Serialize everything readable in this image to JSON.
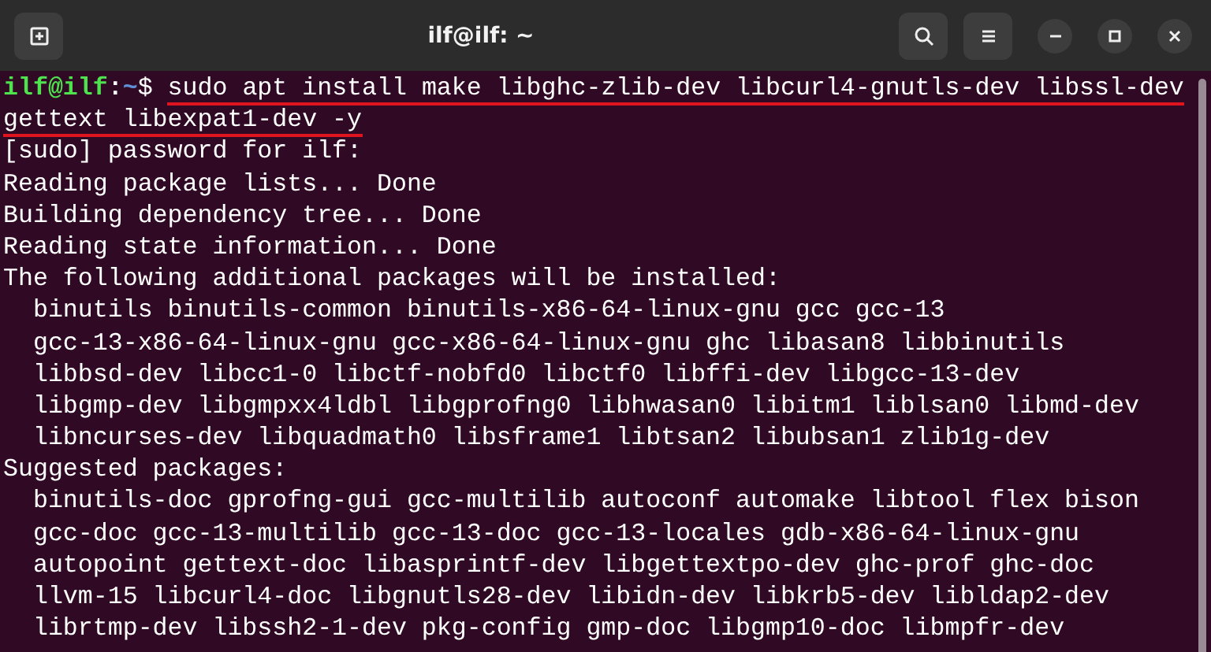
{
  "window": {
    "title": "ilf@ilf: ~"
  },
  "terminal": {
    "lines": [
      {
        "kind": "prompt",
        "user": "ilf@ilf",
        "separator": ":",
        "path": "~",
        "symbol": "$",
        "text": "sudo apt install make libghc-zlib-dev libcurl4-gnutls-dev libssl-dev",
        "underlined": true
      },
      {
        "kind": "output",
        "text": "gettext libexpat1-dev -y",
        "underlined": true
      },
      {
        "kind": "output",
        "text": "[sudo] password for ilf:",
        "underlined": false
      },
      {
        "kind": "output",
        "text": "Reading package lists... Done",
        "underlined": false
      },
      {
        "kind": "output",
        "text": "Building dependency tree... Done",
        "underlined": false
      },
      {
        "kind": "output",
        "text": "Reading state information... Done",
        "underlined": false
      },
      {
        "kind": "output",
        "text": "The following additional packages will be installed:",
        "underlined": false
      },
      {
        "kind": "output",
        "text": "  binutils binutils-common binutils-x86-64-linux-gnu gcc gcc-13",
        "underlined": false
      },
      {
        "kind": "output",
        "text": "  gcc-13-x86-64-linux-gnu gcc-x86-64-linux-gnu ghc libasan8 libbinutils",
        "underlined": false
      },
      {
        "kind": "output",
        "text": "  libbsd-dev libcc1-0 libctf-nobfd0 libctf0 libffi-dev libgcc-13-dev",
        "underlined": false
      },
      {
        "kind": "output",
        "text": "  libgmp-dev libgmpxx4ldbl libgprofng0 libhwasan0 libitm1 liblsan0 libmd-dev",
        "underlined": false
      },
      {
        "kind": "output",
        "text": "  libncurses-dev libquadmath0 libsframe1 libtsan2 libubsan1 zlib1g-dev",
        "underlined": false
      },
      {
        "kind": "output",
        "text": "Suggested packages:",
        "underlined": false
      },
      {
        "kind": "output",
        "text": "  binutils-doc gprofng-gui gcc-multilib autoconf automake libtool flex bison",
        "underlined": false
      },
      {
        "kind": "output",
        "text": "  gcc-doc gcc-13-multilib gcc-13-doc gcc-13-locales gdb-x86-64-linux-gnu",
        "underlined": false
      },
      {
        "kind": "output",
        "text": "  autopoint gettext-doc libasprintf-dev libgettextpo-dev ghc-prof ghc-doc",
        "underlined": false
      },
      {
        "kind": "output",
        "text": "  llvm-15 libcurl4-doc libgnutls28-dev libidn-dev libkrb5-dev libldap2-dev",
        "underlined": false
      },
      {
        "kind": "output",
        "text": "  librtmp-dev libssh2-1-dev pkg-config gmp-doc libgmp10-doc libmpfr-dev",
        "underlined": false
      }
    ]
  }
}
